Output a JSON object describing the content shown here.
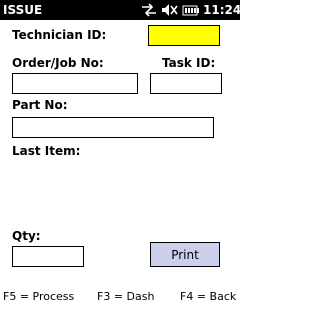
{
  "title_bar": {
    "app_title": "ISSUE",
    "time": "11:24",
    "icons": [
      "connectivity-icon",
      "volume-muted-icon",
      "battery-icon"
    ]
  },
  "form": {
    "technician_id": {
      "label": "Technician ID:",
      "value": ""
    },
    "order_job_no": {
      "label": "Order/Job No:",
      "value": ""
    },
    "task_id": {
      "label": "Task ID:",
      "value": ""
    },
    "part_no": {
      "label": "Part No:",
      "value": ""
    },
    "last_item": {
      "label": "Last Item:",
      "value": ""
    },
    "qty": {
      "label": "Qty:",
      "value": ""
    },
    "print_button": "Print"
  },
  "function_keys": {
    "f5": "F5 = Process",
    "f3": "F3 = Dash",
    "f4": "F4 = Back"
  },
  "colors": {
    "title_bar_bg": "#000000",
    "highlight_field": "#ffff00",
    "button_bg": "#cccfec"
  }
}
